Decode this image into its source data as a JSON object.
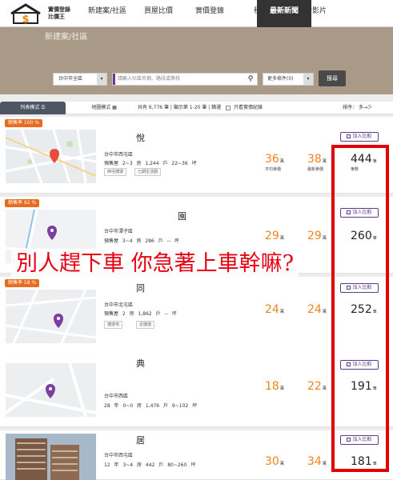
{
  "app": {
    "logo_line1": "實價登錄",
    "logo_line2": "比價王"
  },
  "nav": {
    "items": [
      "新建案/社區",
      "買屋比價",
      "實價登錄",
      "租屋",
      "最新影片"
    ],
    "active": "最新新聞"
  },
  "hero": {
    "title": "新建案/社區",
    "city_select": "台中市全區",
    "search_placeholder": "請輸入社區名稱、路段或學校",
    "more_filter": "更多條件(0)",
    "search_button": "搜尋"
  },
  "toolbar": {
    "list_tab": "列表模式",
    "map_tab": "地圖模式",
    "result_info": "共有 6,776 筆 | 顯示第 1-20 筆 | 篩選",
    "checkbox_label": "只看實價紀錄",
    "sort_label": "排序：",
    "sort_value": "多→少"
  },
  "labels": {
    "avg_price": "平均單價",
    "max_price": "最新單價",
    "deal_count": "筆數",
    "compare": "加入比較",
    "unit_wan": "萬",
    "unit_bi": "筆"
  },
  "cards": [
    {
      "name": "悅",
      "badge": "銷售率 100 %",
      "address": "台中市西屯區",
      "meta": "預售屋   2~3 房   1,244 戶   22~36 坪",
      "tags": [
        "西屯捷運",
        "七期生活圈"
      ],
      "avg_price": "36",
      "max_price": "38",
      "deals": "444"
    },
    {
      "name": "園",
      "badge": "銷售率 92 %",
      "address": "台中市潭子區",
      "meta": "預售屋   3~4 房   286 戶   -- 坪",
      "tags": [],
      "avg_price": "29",
      "max_price": "29",
      "deals": "260"
    },
    {
      "name": "同",
      "badge": "銷售率 58 %",
      "address": "台中市北屯區",
      "meta": "預售屋   2 房   1,862 戶   -- 坪",
      "tags": [
        "捷運宅",
        "近捷運"
      ],
      "avg_price": "24",
      "max_price": "24",
      "deals": "252"
    },
    {
      "name": "典",
      "badge": "",
      "address": "台中市西區",
      "meta": "28 年   0~0 房   1,476 戶   9~102 坪",
      "tags": [],
      "avg_price": "18",
      "max_price": "22",
      "deals": "191"
    },
    {
      "name": "居",
      "badge": "",
      "address": "台中市西屯區",
      "meta": "12 年   3~4 房   442 戶   80~260 坪",
      "tags": [],
      "avg_price": "30",
      "max_price": "34",
      "deals": "181"
    }
  ],
  "overlay": {
    "caption": "別人趕下車 你急著上車幹嘛?",
    "frame_color": "#e00000",
    "caption_color": "#e60012"
  },
  "colors": {
    "accent_orange": "#f0831c",
    "brand_purple": "#5d3c89",
    "badge_orange": "#e86b1f"
  }
}
